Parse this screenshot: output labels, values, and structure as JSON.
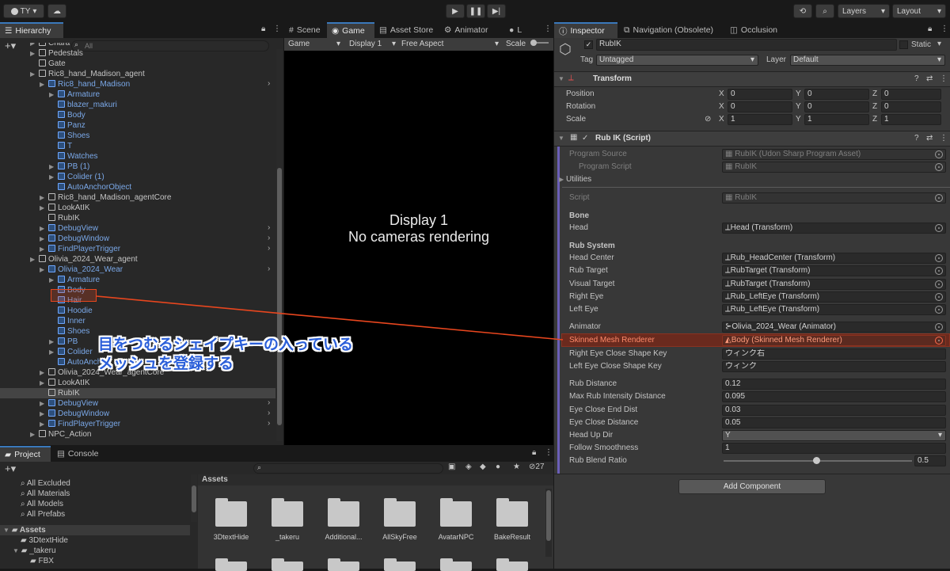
{
  "toolbar": {
    "account": "TY",
    "layers": "Layers",
    "layout": "Layout"
  },
  "hierarchy": {
    "tab": "Hierarchy",
    "search_placeholder": "All",
    "items": [
      {
        "label": "Chara",
        "blue": false,
        "arrow": true
      },
      {
        "label": "Pedestals",
        "blue": false,
        "arrow": true
      },
      {
        "label": "Gate",
        "blue": false,
        "arrow": false
      },
      {
        "label": "Ric8_hand_Madison_agent",
        "blue": false,
        "arrow": true
      },
      {
        "label": "Ric8_hand_Madison",
        "blue": true,
        "arrow": true
      },
      {
        "label": "Armature",
        "blue": true,
        "arrow": true
      },
      {
        "label": "blazer_makuri",
        "blue": true,
        "arrow": false
      },
      {
        "label": "Body",
        "blue": true,
        "arrow": false
      },
      {
        "label": "Panz",
        "blue": true,
        "arrow": false
      },
      {
        "label": "Shoes",
        "blue": true,
        "arrow": false
      },
      {
        "label": "T",
        "blue": true,
        "arrow": false
      },
      {
        "label": "Watches",
        "blue": true,
        "arrow": false
      },
      {
        "label": "PB (1)",
        "blue": true,
        "arrow": true
      },
      {
        "label": "Colider (1)",
        "blue": true,
        "arrow": true
      },
      {
        "label": "AutoAnchorObject",
        "blue": true,
        "arrow": false
      },
      {
        "label": "Ric8_hand_Madison_agentCore",
        "blue": false,
        "arrow": true
      },
      {
        "label": "LookAtIK",
        "blue": false,
        "arrow": true
      },
      {
        "label": "RubIK",
        "blue": false,
        "arrow": false
      },
      {
        "label": "DebugView",
        "blue": true,
        "arrow": true
      },
      {
        "label": "DebugWindow",
        "blue": true,
        "arrow": true
      },
      {
        "label": "FindPlayerTrigger",
        "blue": true,
        "arrow": true
      },
      {
        "label": "Olivia_2024_Wear_agent",
        "blue": false,
        "arrow": true
      },
      {
        "label": "Olivia_2024_Wear",
        "blue": true,
        "arrow": true
      },
      {
        "label": "Armature",
        "blue": true,
        "arrow": true
      },
      {
        "label": "Body",
        "blue": true,
        "arrow": false
      },
      {
        "label": "Hair",
        "blue": true,
        "arrow": false
      },
      {
        "label": "Hoodie",
        "blue": true,
        "arrow": false
      },
      {
        "label": "Inner",
        "blue": true,
        "arrow": false
      },
      {
        "label": "Shoes",
        "blue": true,
        "arrow": false
      },
      {
        "label": "PB",
        "blue": true,
        "arrow": true
      },
      {
        "label": "Colider",
        "blue": true,
        "arrow": true
      },
      {
        "label": "AutoAnch",
        "blue": true,
        "arrow": false
      },
      {
        "label": "Olivia_2024_Wear_agentCore",
        "blue": false,
        "arrow": true
      },
      {
        "label": "LookAtIK",
        "blue": false,
        "arrow": true
      },
      {
        "label": "RubIK",
        "blue": false,
        "arrow": false
      },
      {
        "label": "DebugView",
        "blue": true,
        "arrow": true
      },
      {
        "label": "DebugWindow",
        "blue": true,
        "arrow": true
      },
      {
        "label": "FindPlayerTrigger",
        "blue": true,
        "arrow": true
      },
      {
        "label": "NPC_Action",
        "blue": false,
        "arrow": true
      }
    ]
  },
  "annotation": {
    "line1": "目をつむるシェイプキーの入っている",
    "line2": "メッシュを登録する"
  },
  "game": {
    "tabs": [
      "Scene",
      "Game",
      "Asset Store",
      "Animator",
      "L"
    ],
    "mode": "Game",
    "display": "Display 1",
    "aspect": "Free Aspect",
    "scale": "Scale",
    "message_title": "Display 1",
    "message_body": "No cameras rendering"
  },
  "project": {
    "tabs": [
      "Project",
      "Console"
    ],
    "hidden_count": "27",
    "favorites": [
      "All Excluded",
      "All Materials",
      "All Models",
      "All Prefabs"
    ],
    "tree": [
      "Assets",
      "3DtextHide",
      "_takeru",
      "FBX"
    ],
    "assets_header": "Assets",
    "folders": [
      "3DtextHide",
      "_takeru",
      "Additional...",
      "AllSkyFree",
      "AvatarNPC",
      "BakeResult"
    ]
  },
  "inspector": {
    "tabs": [
      "Inspector",
      "Navigation (Obsolete)",
      "Occlusion"
    ],
    "object_name": "RubIK",
    "static_label": "Static",
    "tag_label": "Tag",
    "tag_value": "Untagged",
    "layer_label": "Layer",
    "layer_value": "Default",
    "transform": {
      "title": "Transform",
      "position_label": "Position",
      "rotation_label": "Rotation",
      "scale_label": "Scale",
      "axes": [
        "X",
        "Y",
        "Z"
      ],
      "position": [
        "0",
        "0",
        "0"
      ],
      "rotation": [
        "0",
        "0",
        "0"
      ],
      "scale": [
        "1",
        "1",
        "1"
      ]
    },
    "script": {
      "title": "Rub IK (Script)",
      "program_source_label": "Program Source",
      "program_source": "RubIK (Udon Sharp Program Asset)",
      "program_script_label": "Program Script",
      "program_script": "RubIK",
      "utilities": "Utilities",
      "script_label": "Script",
      "script_value": "RubIK",
      "bone_header": "Bone",
      "head_label": "Head",
      "head_value": "Head (Transform)",
      "rub_header": "Rub System",
      "rows": [
        {
          "label": "Head Center",
          "value": "Rub_HeadCenter (Transform)"
        },
        {
          "label": "Rub Target",
          "value": "RubTarget (Transform)"
        },
        {
          "label": "Visual Target",
          "value": "RubTarget (Transform)"
        },
        {
          "label": "Right Eye",
          "value": "Rub_LeftEye (Transform)"
        },
        {
          "label": "Left Eye",
          "value": "Rub_LeftEye (Transform)"
        }
      ],
      "animator_label": "Animator",
      "animator_value": "Olivia_2024_Wear (Animator)",
      "smr_label": "Skinned Mesh Renderer",
      "smr_value": "Body (Skinned Mesh Renderer)",
      "right_eye_key_label": "Right Eye Close Shape Key",
      "right_eye_key_value": "ウィンク右",
      "left_eye_key_label": "Left Eye Close Shape Key",
      "left_eye_key_value": "ウィンク",
      "params": [
        {
          "label": "Rub Distance",
          "value": "0.12"
        },
        {
          "label": "Max Rub Intensity Distance",
          "value": "0.095"
        },
        {
          "label": "Eye Close End Dist",
          "value": "0.03"
        },
        {
          "label": "Eye Close Distance",
          "value": "0.05"
        }
      ],
      "head_up_dir_label": "Head Up Dir",
      "head_up_dir_value": "Y",
      "follow_smoothness_label": "Follow Smoothness",
      "follow_smoothness_value": "1",
      "rub_blend_ratio_label": "Rub Blend Ratio",
      "rub_blend_ratio_value": "0.5",
      "rub_blend_ratio_fraction": 0.5
    },
    "add_component": "Add Component"
  },
  "colors": {
    "accent": "#3a79bb",
    "highlight": "#e8461e",
    "prefab_blue": "#7aa8e8",
    "annotation_text": "#2b5fd9"
  }
}
